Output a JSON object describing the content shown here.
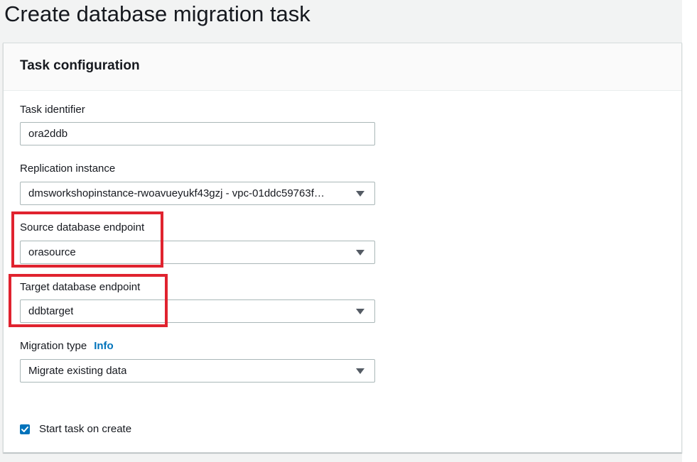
{
  "page": {
    "title": "Create database migration task"
  },
  "panel": {
    "title": "Task configuration"
  },
  "fields": {
    "task_identifier": {
      "label": "Task identifier",
      "value": "ora2ddb"
    },
    "replication_instance": {
      "label": "Replication instance",
      "value": "dmsworkshopinstance-rwoavueyukf43gzj - vpc-01ddc59763f…"
    },
    "source_endpoint": {
      "label": "Source database endpoint",
      "value": "orasource"
    },
    "target_endpoint": {
      "label": "Target database endpoint",
      "value": "ddbtarget"
    },
    "migration_type": {
      "label": "Migration type",
      "info": "Info",
      "value": "Migrate existing data"
    }
  },
  "start_task": {
    "label": "Start task on create",
    "checked": true
  },
  "colors": {
    "accent": "#0073bb",
    "highlight": "#e0232f",
    "background": "#f2f3f3"
  }
}
